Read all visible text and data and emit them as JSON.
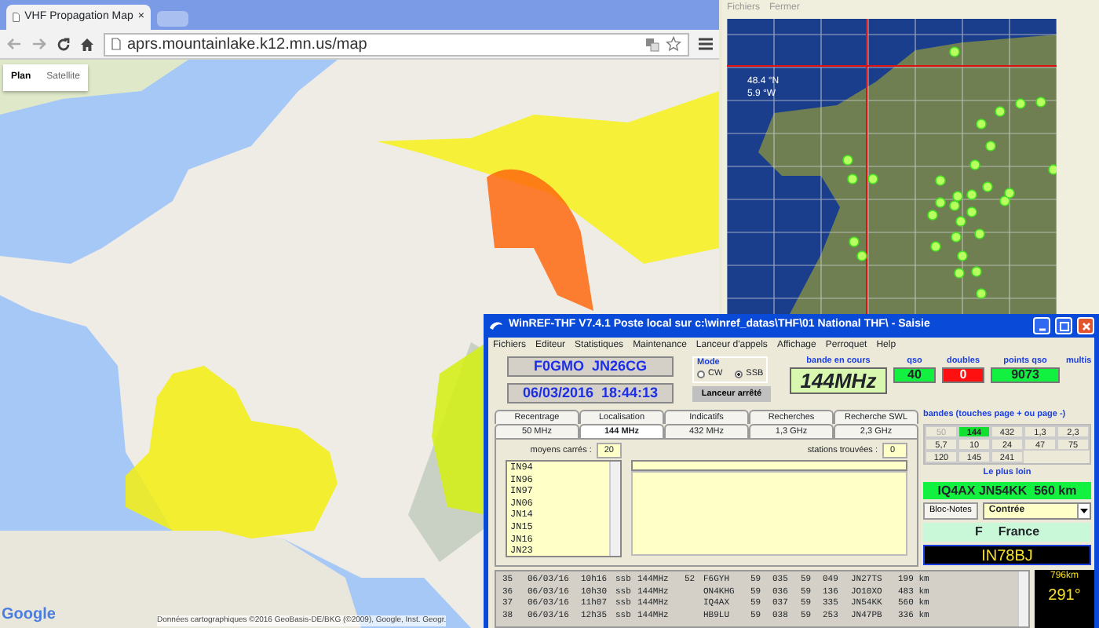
{
  "browser": {
    "tab_title": "VHF Propagation Map",
    "tab_close": "×",
    "url": "aprs.mountainlake.k12.mn.us/map",
    "map_types": [
      {
        "label": "Plan",
        "selected": true
      },
      {
        "label": "Satellite",
        "selected": false
      }
    ],
    "logo": "Google",
    "attribution": "Données cartographiques ©2016 GeoBasis-DE/BKG (©2009), Google, Inst. Geogr."
  },
  "locator_map": {
    "menu": [
      "Fichiers",
      "Fermer"
    ],
    "coordinates": [
      "48.4 °N",
      "5.9 °W"
    ]
  },
  "winref": {
    "title": "WinREF-THF V7.4.1 Poste local sur c:\\winref_datas\\THF\\01 National THF\\ -  Saisie",
    "menu": [
      "Fichiers",
      "Editeur",
      "Statistiques",
      "Maintenance",
      "Lanceur d'appels",
      "Affichage",
      "Perroquet",
      "Help"
    ],
    "callsign": "F0GMO  JN26CG",
    "datetime": "06/03/2016  18:44:13",
    "mode": {
      "label": "Mode",
      "options": [
        {
          "label": "CW",
          "selected": false
        },
        {
          "label": "SSB",
          "selected": true
        }
      ]
    },
    "launcher_button": "Lanceur arrêté",
    "band": {
      "label": "bande en cours",
      "value": "144MHz"
    },
    "counters": [
      {
        "label": "qso",
        "value": "40",
        "kind": "good"
      },
      {
        "label": "doubles",
        "value": "0",
        "kind": "bad"
      },
      {
        "label": "points qso",
        "value": "9073",
        "kind": "good"
      },
      {
        "label": "multis",
        "kind": "empty"
      }
    ],
    "tabs_top": [
      {
        "label": "Recentrage",
        "selected": false
      },
      {
        "label": "Localisation",
        "selected": false
      },
      {
        "label": "Indicatifs",
        "selected": false
      },
      {
        "label": "Recherches",
        "selected": false
      },
      {
        "label": "Recherche SWL",
        "selected": false
      }
    ],
    "tabs_bottom": [
      {
        "label": "50 MHz",
        "selected": false
      },
      {
        "label": "144 MHz",
        "selected": true
      },
      {
        "label": "432 MHz",
        "selected": false
      },
      {
        "label": "1,3 GHz",
        "selected": false
      },
      {
        "label": "2,3 GHz",
        "selected": false
      }
    ],
    "squares_label": "moyens carrés :",
    "squares_count": "20",
    "squares": [
      "IN94",
      "IN96",
      "IN97",
      "JN06",
      "JN14",
      "JN15",
      "JN16",
      "JN23"
    ],
    "found_label": "stations trouvées :",
    "found_count": "0",
    "bands_label": "bandes (touches page + ou page -)",
    "bands": [
      {
        "label": "50",
        "selected": false,
        "disabled": true
      },
      {
        "label": "144",
        "selected": true,
        "disabled": false
      },
      {
        "label": "432",
        "selected": false,
        "disabled": false
      },
      {
        "label": "1,3",
        "selected": false,
        "disabled": false
      },
      {
        "label": "2,3",
        "selected": false,
        "disabled": false
      },
      {
        "label": "5,7",
        "selected": false,
        "disabled": false
      },
      {
        "label": "10",
        "selected": false,
        "disabled": false
      },
      {
        "label": "24",
        "selected": false,
        "disabled": false
      },
      {
        "label": "47",
        "selected": false,
        "disabled": false
      },
      {
        "label": "75",
        "selected": false,
        "disabled": false
      },
      {
        "label": "120",
        "selected": false,
        "disabled": false
      },
      {
        "label": "145",
        "selected": false,
        "disabled": false
      },
      {
        "label": "241",
        "selected": false,
        "disabled": false
      }
    ],
    "farthest_label": "Le plus loin",
    "farthest": "IQ4AX JN54KK  560 km",
    "notes_button": "Bloc-Notes",
    "country_dropdown": "Contrée",
    "country_prefix": "F",
    "country_name": "France",
    "locator": "IN78BJ",
    "distance": "796km",
    "bearing": "291°",
    "log_rows": [
      [
        "35",
        "06/03/16",
        "10h16",
        "ssb",
        "144MHz",
        "52",
        "F6GYH",
        "59",
        "035",
        "59",
        "049",
        "JN27TS",
        "199 km"
      ],
      [
        "36",
        "06/03/16",
        "10h30",
        "ssb",
        "144MHz",
        "",
        "ON4KHG",
        "59",
        "036",
        "59",
        "136",
        "JO10XO",
        "483 km"
      ],
      [
        "37",
        "06/03/16",
        "11h07",
        "ssb",
        "144MHz",
        "",
        "IQ4AX",
        "59",
        "037",
        "59",
        "335",
        "JN54KK",
        "560 km"
      ],
      [
        "38",
        "06/03/16",
        "12h35",
        "ssb",
        "144MHz",
        "",
        "HB9LU",
        "59",
        "038",
        "59",
        "253",
        "JN47PB",
        "336 km"
      ]
    ]
  }
}
